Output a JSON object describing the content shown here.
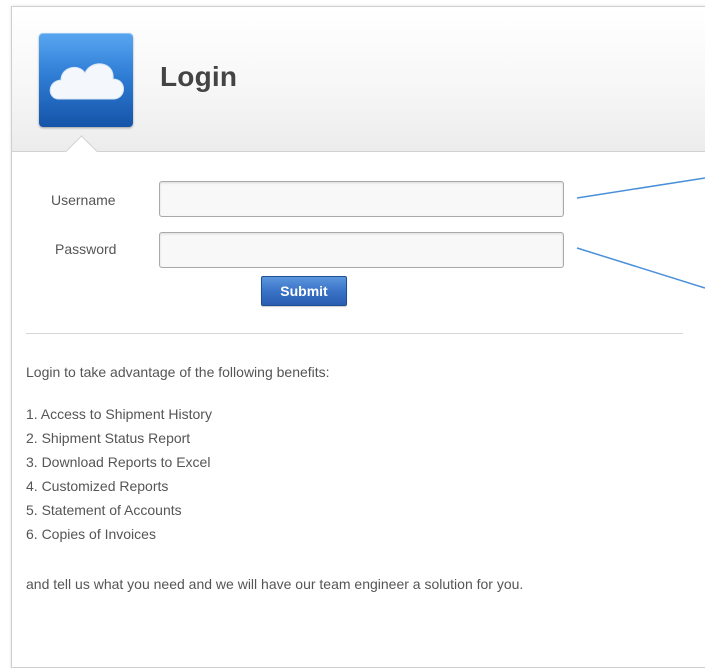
{
  "header": {
    "title": "Login",
    "logo_icon": "cloud-icon"
  },
  "form": {
    "username_label": "Username",
    "username_value": "",
    "password_label": "Password",
    "password_value": "",
    "submit_label": "Submit"
  },
  "info": {
    "intro": "Login to take advantage of the following benefits:",
    "benefits": [
      "1. Access to Shipment History",
      "2. Shipment Status Report",
      "3. Download Reports to Excel",
      "4. Customized Reports",
      "5. Statement of Accounts",
      "6. Copies of Invoices"
    ],
    "closing": "and tell us what you need and we will have our team engineer a solution for you."
  },
  "colors": {
    "accent_blue": "#2f7dd5",
    "button_blue": "#3a73c7",
    "callout_line": "#4a90d9",
    "text": "#555555"
  }
}
